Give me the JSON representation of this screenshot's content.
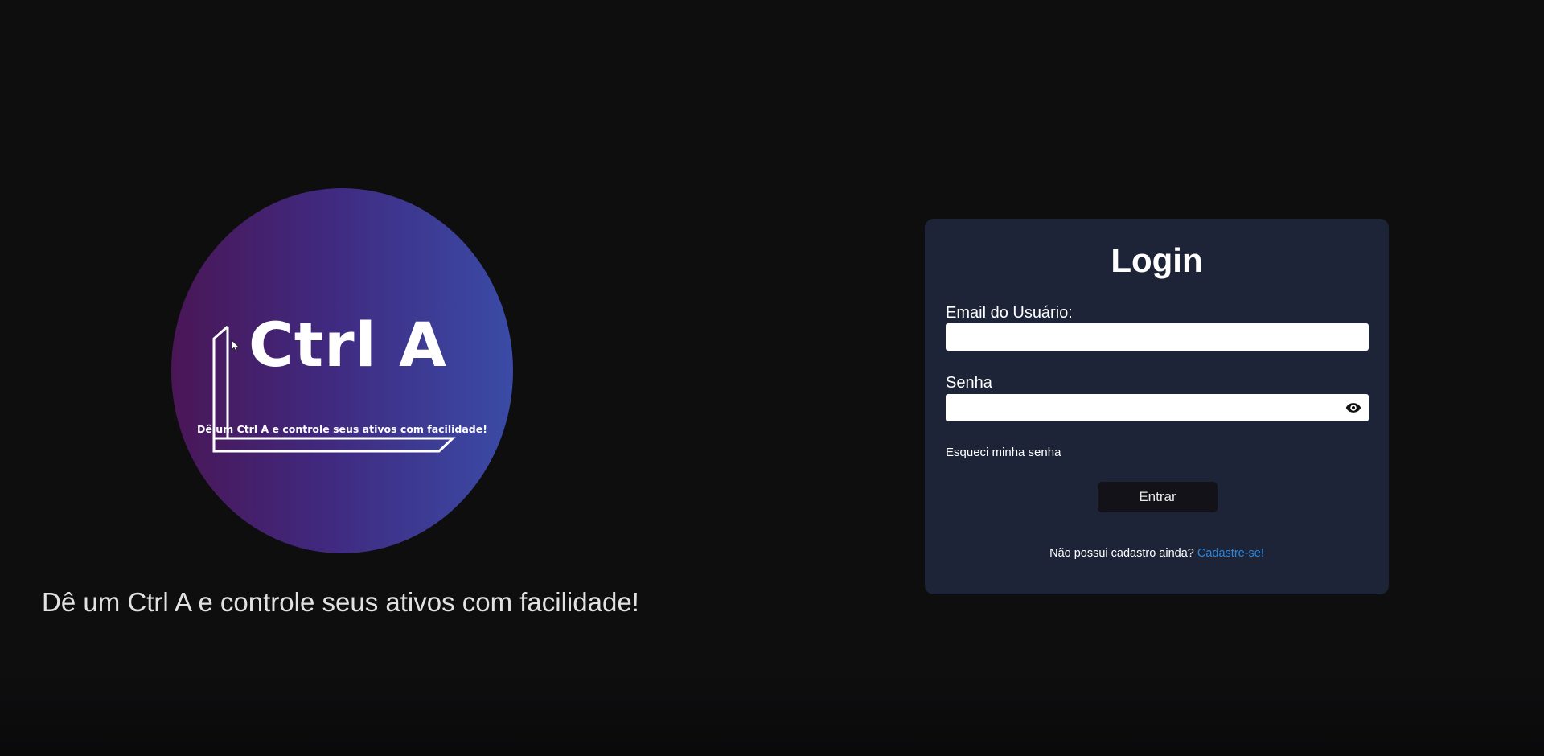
{
  "brand": {
    "logo_word": "Ctrl A",
    "logo_slogan": "Dê um Ctrl A e controle seus ativos com facilidade!",
    "tagline": "Dê um Ctrl A e controle seus ativos com facilidade!",
    "gradient_colors": [
      "#4a1656",
      "#40297f",
      "#3a4ba6"
    ]
  },
  "login": {
    "title": "Login",
    "email_label": "Email do Usuário:",
    "email_value": "",
    "password_label": "Senha",
    "password_value": "",
    "toggle_visibility_icon": "eye-icon",
    "forgot_password": "Esqueci minha senha",
    "submit_label": "Entrar",
    "signup_prompt": "Não possui cadastro ainda? ",
    "signup_link": "Cadastre-se!",
    "card_color": "#1e2438",
    "link_color": "#2f86d8"
  }
}
